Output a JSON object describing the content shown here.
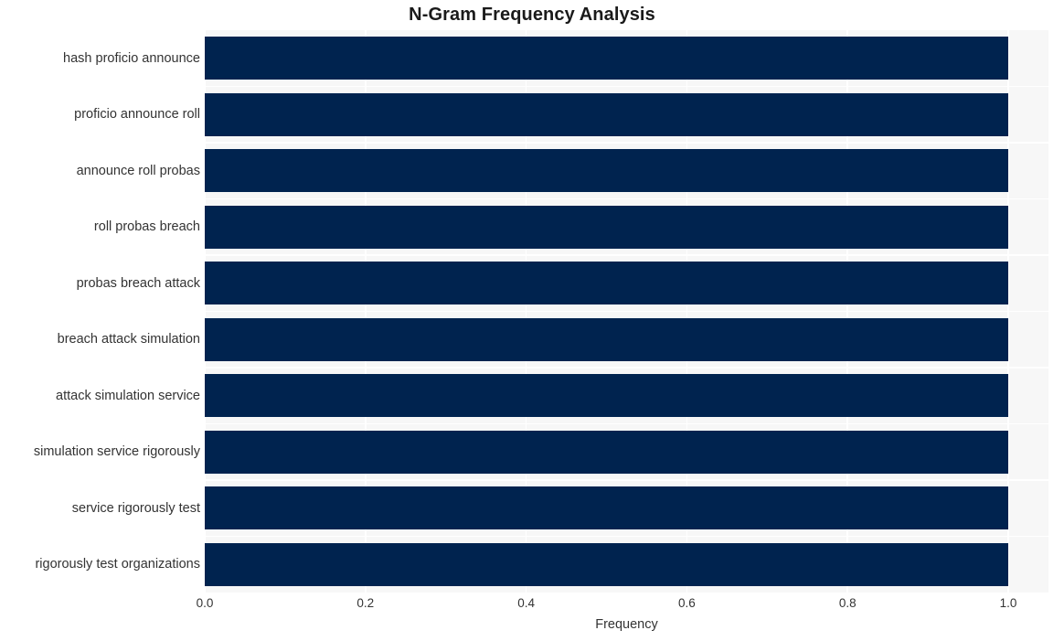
{
  "chart_data": {
    "type": "bar",
    "orientation": "horizontal",
    "title": "N-Gram Frequency Analysis",
    "xlabel": "Frequency",
    "ylabel": "",
    "categories": [
      "hash proficio announce",
      "proficio announce roll",
      "announce roll probas",
      "roll probas breach",
      "probas breach attack",
      "breach attack simulation",
      "attack simulation service",
      "simulation service rigorously",
      "service rigorously test",
      "rigorously test organizations"
    ],
    "values": [
      1.0,
      1.0,
      1.0,
      1.0,
      1.0,
      1.0,
      1.0,
      1.0,
      1.0,
      1.0
    ],
    "xlim": [
      0.0,
      1.05
    ],
    "xticks": [
      "0.0",
      "0.2",
      "0.4",
      "0.6",
      "0.8",
      "1.0"
    ],
    "xtick_values": [
      0.0,
      0.2,
      0.4,
      0.6,
      0.8,
      1.0
    ],
    "grid": true,
    "legend": false,
    "bar_color": "#00234f",
    "plot_background": "#f7f7f7",
    "gridline_color": "#ffffff",
    "figure_background": "#ffffff",
    "text_color": "#333333",
    "title_color": "#1a1a1a"
  }
}
